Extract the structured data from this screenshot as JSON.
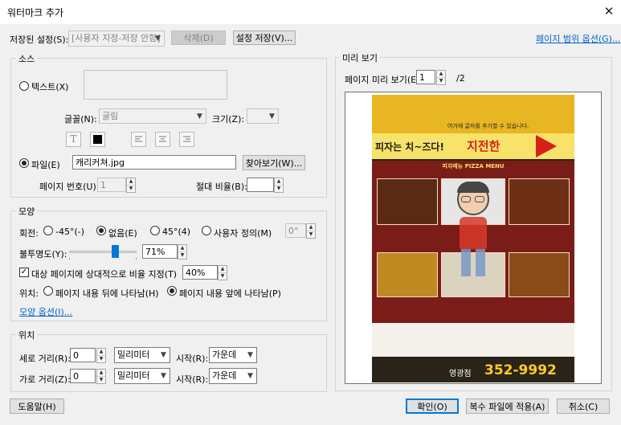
{
  "window": {
    "title": "워터마크 추가",
    "close_glyph": "✕"
  },
  "saved_settings": {
    "label": "저장된 설정(S):",
    "value": "[사용자 지정-저장 안함]",
    "delete_label": "삭제(D)",
    "save_label": "설정 저장(V)...",
    "page_range_link": "페이지 범위 옵션(G)..."
  },
  "source": {
    "legend": "소스",
    "text_radio": "텍스트(X)",
    "font_label": "글꼴(N):",
    "font_value": "굴림",
    "size_label": "크기(Z):",
    "text_icon": "T",
    "file_radio": "파일(E)",
    "file_value": "캐리커쳐.jpg",
    "browse_label": "찾아보기(W)...",
    "page_no_label": "페이지 번호(U):",
    "page_no_value": "1",
    "abs_scale_label": "절대 비율(B):"
  },
  "appearance": {
    "legend": "모양",
    "rotation_label": "회전:",
    "rot_minus45": "-45°(-)",
    "rot_none": "없음(E)",
    "rot_45": "45°(4)",
    "rot_custom": "사용자 정의(M)",
    "rot_custom_value": "0°",
    "opacity_label": "불투명도(Y):",
    "opacity_value": "71%",
    "opacity_fraction": 0.71,
    "relative_scale_label": "대상 페이지에 상대적으로 비율 지정(T)",
    "relative_scale_value": "40%",
    "position_label": "위치:",
    "behind_label": "페이지 내용 뒤에 나타남(H)",
    "front_label": "페이지 내용 앞에 나타남(P)",
    "options_link": "모양 옵션(I)..."
  },
  "position": {
    "legend": "위치",
    "vertical_label": "세로 거리(R):",
    "vertical_value": "0",
    "horizontal_label": "가로 거리(Z):",
    "horizontal_value": "0",
    "unit_value": "밀리미터",
    "from_label": "시작(R):",
    "from_value": "가운데"
  },
  "preview": {
    "legend": "미리 보기",
    "page_label": "페이지 미리 보기(E)",
    "page_value": "1",
    "page_total": "/2",
    "poster_slogan": "어거에 글자를 추가할 수 있습니다.",
    "poster_headline": "피자는 치~즈다!",
    "poster_brand": "지전한",
    "poster_menu_title": "피자메뉴 PIZZA MENU",
    "poster_branch": "영광점",
    "poster_phone": "352-9992"
  },
  "footer": {
    "help_label": "도움말(H)",
    "ok_label": "확인(O)",
    "apply_multi_label": "복수 파일에 적용(A)",
    "cancel_label": "취소(C)"
  }
}
